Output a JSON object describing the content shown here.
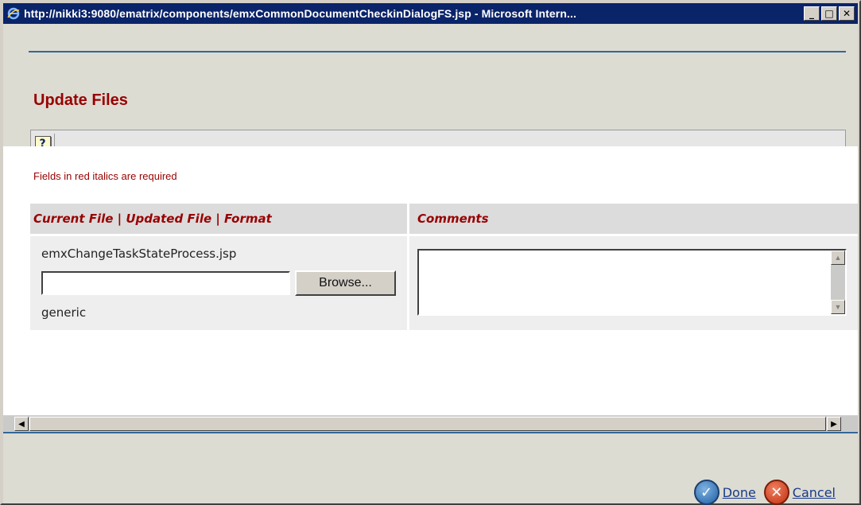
{
  "window": {
    "title": "http://nikki3:9080/ematrix/components/emxCommonDocumentCheckinDialogFS.jsp - Microsoft Intern...",
    "minimize": "_",
    "maximize": "□",
    "close": "✕"
  },
  "header": {
    "title": "Update Files"
  },
  "toolbar": {
    "help_glyph": "?"
  },
  "form": {
    "required_note": "Fields in red italics are required",
    "col_left_header": "Current File | Updated File | Format",
    "col_right_header": "Comments",
    "current_file": "emxChangeTaskStateProcess.jsp",
    "updated_file_value": "",
    "browse_label": "Browse...",
    "format": "generic",
    "comments_value": ""
  },
  "footer": {
    "done_label": "Done",
    "cancel_label": "Cancel"
  },
  "colors": {
    "title_red": "#990000",
    "titlebar_blue": "#0a246a",
    "rule_blue": "#336699"
  }
}
